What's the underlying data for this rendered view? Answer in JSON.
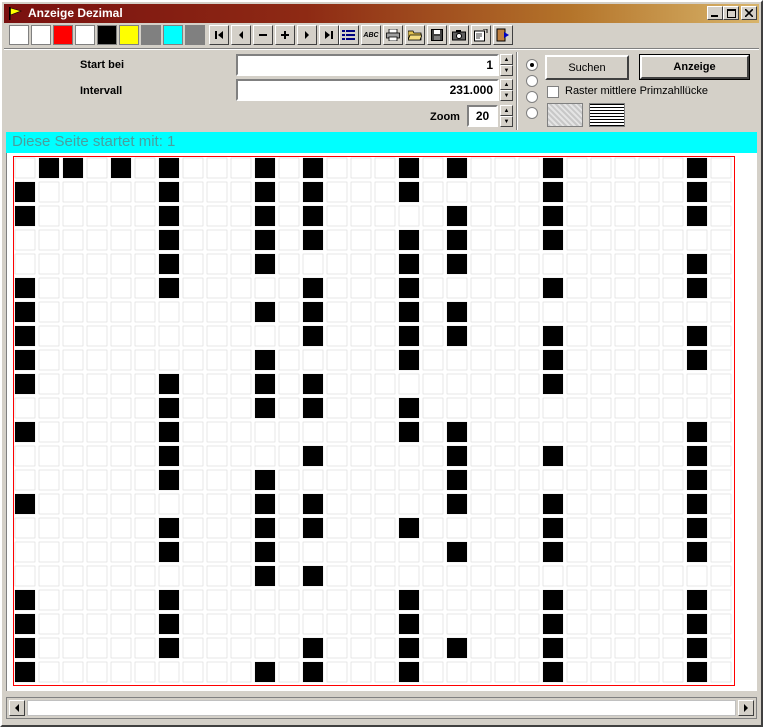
{
  "window": {
    "title": "Anzeige Dezimal"
  },
  "toolbar": {
    "colors": [
      "#ffffff",
      "#ffffff",
      "#ff0000",
      "#ffffff",
      "#000000",
      "#ffff00",
      "#808080",
      "#00ffff",
      "#808080"
    ],
    "buttons": [
      {
        "name": "first-page-button",
        "icon": "skip-start-icon"
      },
      {
        "name": "prev-button",
        "icon": "triangle-left-icon"
      },
      {
        "name": "minus-button",
        "icon": "minus-icon"
      },
      {
        "name": "plus-button",
        "icon": "plus-icon"
      },
      {
        "name": "next-button",
        "icon": "triangle-right-icon"
      },
      {
        "name": "last-page-button",
        "icon": "skip-end-icon"
      },
      {
        "name": "list-button",
        "icon": "list-icon"
      },
      {
        "name": "spelling-button",
        "icon": "abc-icon",
        "text": "ABC"
      },
      {
        "name": "print-button",
        "icon": "printer-icon"
      },
      {
        "name": "open-button",
        "icon": "folder-icon"
      },
      {
        "name": "save-button",
        "icon": "floppy-icon"
      },
      {
        "name": "camera-button",
        "icon": "camera-icon"
      },
      {
        "name": "properties-button",
        "icon": "properties-icon"
      },
      {
        "name": "exit-button",
        "icon": "exit-icon"
      }
    ]
  },
  "form": {
    "start_label": "Start bei",
    "start_value": "1",
    "interval_label": "Intervall",
    "interval_value": "231.000",
    "zoom_label": "Zoom",
    "zoom_value": "20"
  },
  "options": {
    "selected_radio": 0,
    "search_label": "Suchen",
    "display_label": "Anzeige",
    "raster_label": "Raster mittlere Primzahllücke",
    "raster_checked": false
  },
  "banner": {
    "text": "Diese Seite startet mit: 1"
  },
  "grid": {
    "cols": 30,
    "rows": 22,
    "filled": [
      [
        1,
        2,
        4,
        6,
        10,
        12,
        16,
        18,
        22,
        28
      ],
      [
        0,
        6,
        10,
        12,
        16,
        22,
        28
      ],
      [
        0,
        6,
        10,
        12,
        18,
        22,
        28
      ],
      [
        6,
        10,
        12,
        16,
        18,
        22
      ],
      [
        6,
        10,
        16,
        18,
        28
      ],
      [
        0,
        6,
        12,
        16,
        22,
        28
      ],
      [
        0,
        10,
        12,
        16,
        18
      ],
      [
        0,
        12,
        16,
        18,
        22,
        28
      ],
      [
        0,
        10,
        16,
        22,
        28
      ],
      [
        0,
        6,
        10,
        12,
        22
      ],
      [
        6,
        10,
        12,
        16
      ],
      [
        0,
        6,
        16,
        18,
        28
      ],
      [
        6,
        12,
        18,
        22,
        28
      ],
      [
        6,
        10,
        18,
        28
      ],
      [
        0,
        10,
        12,
        18,
        22,
        28
      ],
      [
        6,
        10,
        12,
        16,
        22,
        28
      ],
      [
        6,
        10,
        18,
        22,
        28
      ],
      [
        10,
        12
      ],
      [
        0,
        6,
        16,
        22,
        28
      ],
      [
        0,
        6,
        16,
        22,
        28
      ],
      [
        0,
        6,
        12,
        16,
        18,
        22,
        28
      ],
      [
        0,
        10,
        12,
        16,
        22,
        28
      ]
    ],
    "colors": {
      "cell": "#000000",
      "grid": "#d8d8d8",
      "border": "#ff0000"
    }
  }
}
